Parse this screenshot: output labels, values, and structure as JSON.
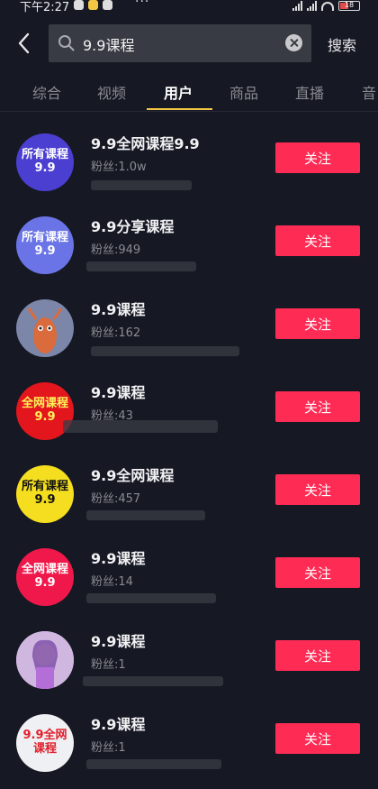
{
  "status_bar": {
    "time": "下午2:27",
    "battery": "18"
  },
  "search": {
    "query": "9.9课程",
    "button_label": "搜索"
  },
  "tabs": [
    "综合",
    "视频",
    "用户",
    "商品",
    "直播",
    "音"
  ],
  "active_tab": "用户",
  "users": [
    {
      "name": "9.9全网课程9.9",
      "fans": "粉丝:1.0w",
      "avatar_text": "所有课程\n9.9",
      "avatar_bg": "#4b3fd1",
      "avatar_color": "#ffffff",
      "follow_label": "关注"
    },
    {
      "name": "9.9分享课程",
      "fans": "粉丝:949",
      "avatar_text": "所有课程\n9.9",
      "avatar_bg": "#6a74e6",
      "avatar_color": "#ffffff",
      "follow_label": "关注"
    },
    {
      "name": "9.9课程",
      "fans": "粉丝:162",
      "avatar_text": "",
      "avatar_bg": "#7b86a8",
      "avatar_color": "#ffffff",
      "follow_label": "关注"
    },
    {
      "name": "9.9课程",
      "fans": "粉丝:43",
      "avatar_text": "全网课程\n9.9",
      "avatar_bg": "#e3161d",
      "avatar_color": "#fff45a",
      "follow_label": "关注"
    },
    {
      "name": "9.9全网课程",
      "fans": "粉丝:457",
      "avatar_text": "所有课程\n9.9",
      "avatar_bg": "#f4de1f",
      "avatar_color": "#111111",
      "follow_label": "关注"
    },
    {
      "name": "9.9课程",
      "fans": "粉丝:14",
      "avatar_text": "全网课程\n9.9",
      "avatar_bg": "#f0184a",
      "avatar_color": "#ffffff",
      "follow_label": "关注"
    },
    {
      "name": "9.9课程",
      "fans": "粉丝:1",
      "avatar_text": "",
      "avatar_bg": "#c9a3d6",
      "avatar_color": "#ffffff",
      "follow_label": "关注"
    },
    {
      "name": "9.9课程",
      "fans": "粉丝:1",
      "avatar_text": "9.9全网\n课程",
      "avatar_bg": "#eef0f4",
      "avatar_color": "#e1202c",
      "follow_label": "关注"
    }
  ],
  "colors": {
    "background": "#161823",
    "follow_button": "#fe2c55",
    "tab_indicator": "#f3c744"
  },
  "icons": {
    "back": "chevron-left-icon",
    "search": "search-icon",
    "clear": "close-circle-icon"
  }
}
